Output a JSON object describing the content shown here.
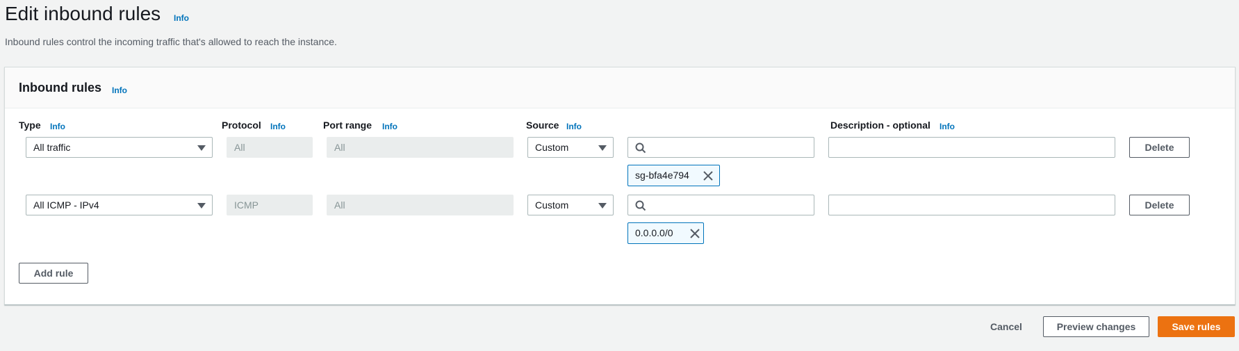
{
  "page": {
    "title": "Edit inbound rules",
    "title_info": "Info",
    "description": "Inbound rules control the incoming traffic that's allowed to reach the instance."
  },
  "panel": {
    "title": "Inbound rules",
    "info": "Info",
    "columns": {
      "type": {
        "label": "Type",
        "info": "Info"
      },
      "protocol": {
        "label": "Protocol",
        "info": "Info"
      },
      "port_range": {
        "label": "Port range",
        "info": "Info"
      },
      "source": {
        "label": "Source",
        "info": "Info"
      },
      "description": {
        "label": "Description - optional",
        "info": "Info"
      }
    },
    "rules": [
      {
        "type": "All traffic",
        "protocol": "All",
        "port_range": "All",
        "source_type": "Custom",
        "source_search_value": "",
        "source_tokens": [
          "sg-bfa4e794"
        ],
        "description": "",
        "delete_label": "Delete"
      },
      {
        "type": "All ICMP - IPv4",
        "protocol": "ICMP",
        "port_range": "All",
        "source_type": "Custom",
        "source_search_value": "",
        "source_tokens": [
          "0.0.0.0/0"
        ],
        "description": "",
        "delete_label": "Delete"
      }
    ],
    "add_rule_label": "Add rule"
  },
  "footer": {
    "cancel_label": "Cancel",
    "preview_label": "Preview changes",
    "save_label": "Save rules"
  },
  "colors": {
    "primary": "#ec7211",
    "link": "#0073bb",
    "token_bg": "#f1faff",
    "token_border": "#0073bb"
  }
}
